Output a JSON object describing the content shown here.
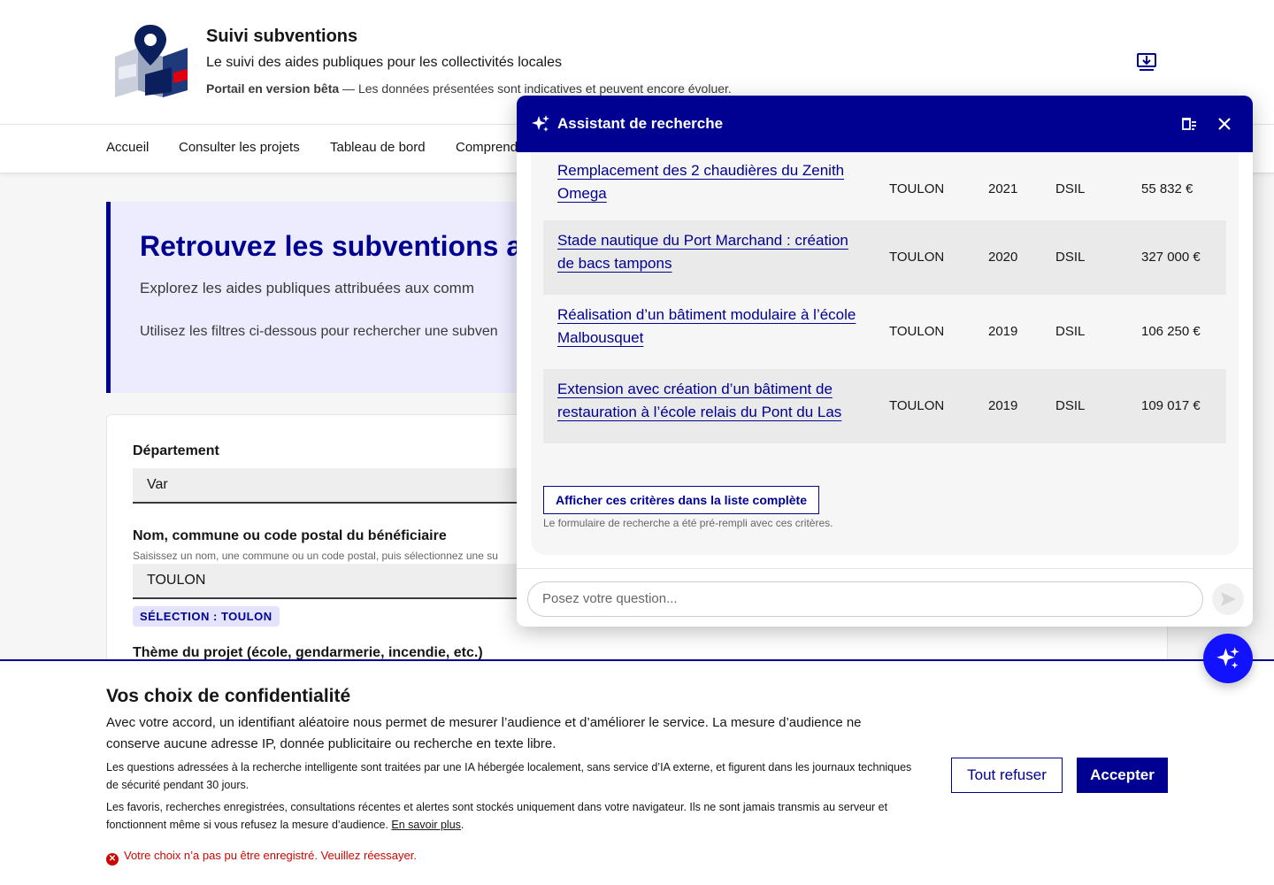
{
  "header": {
    "site_title": "Suivi subventions",
    "tagline": "Le suivi des aides publiques pour les collectivités locales",
    "beta_label": "Portail en version bêta",
    "beta_text": " — Les données présentées sont indicatives et peuvent encore évoluer.",
    "download_icon": "download-icon"
  },
  "nav": {
    "items": [
      "Accueil",
      "Consulter les projets",
      "Tableau de bord",
      "Comprendre"
    ]
  },
  "hero": {
    "title": "Retrouvez les subventions a",
    "subtitle": "Explorez les aides publiques attribuées aux comm",
    "instructions": "Utilisez les filtres ci-dessous pour rechercher une subven"
  },
  "form": {
    "department_label": "Département",
    "department_value": "Var",
    "beneficiary_label": "Nom, commune ou code postal du bénéficiaire",
    "beneficiary_hint": "Saisissez un nom, une commune ou un code postal, puis sélectionnez une su",
    "beneficiary_value": "TOULON",
    "selection_badge": "SÉLECTION : TOULON",
    "theme_label": "Thème du projet (école, gendarmerie, incendie, etc.)"
  },
  "chat": {
    "title": "Assistant de recherche",
    "rows": [
      {
        "title": "Remplacement des 2 chaudières du Zenith Omega",
        "city": "TOULON",
        "year": "2021",
        "program": "DSIL",
        "amount": "55 832 €"
      },
      {
        "title": "Stade nautique du Port Marchand : création de bacs tampons",
        "city": "TOULON",
        "year": "2020",
        "program": "DSIL",
        "amount": "327 000 €"
      },
      {
        "title": "Réalisation d’un bâtiment modulaire à l’école Malbousquet",
        "city": "TOULON",
        "year": "2019",
        "program": "DSIL",
        "amount": "106 250 €"
      },
      {
        "title": "Extension avec création d’un bâtiment de restauration à l’école relais du Pont du Las",
        "city": "TOULON",
        "year": "2019",
        "program": "DSIL",
        "amount": "109 017 €"
      }
    ],
    "criteria_button": "Afficher ces critères dans la liste complète",
    "criteria_note": "Le formulaire de recherche a été pré-rempli avec ces critères.",
    "input_placeholder": "Posez votre question..."
  },
  "consent": {
    "title": "Vos choix de confidentialité",
    "p1": "Avec votre accord, un identifiant aléatoire nous permet de mesurer l’audience et d’améliorer le service. La mesure d’audience ne conserve aucune adresse IP, donnée publicitaire ou recherche en texte libre.",
    "p2": "Les questions adressées à la recherche intelligente sont traitées par une IA hébergée localement, sans service d’IA externe, et figurent dans les journaux techniques de sécurité pendant 30 jours.",
    "p3": "Les favoris, recherches enregistrées, consultations récentes et alertes sont stockés uniquement dans votre navigateur. Ils ne sont jamais transmis au serveur et fonctionnent même si vous refusez la mesure d’audience. ",
    "learn_more": "En savoir plus",
    "p3_end": ".",
    "error": "Votre choix n’a pas pu être enregistré. Veuillez réessayer.",
    "refuse": "Tout refuser",
    "accept": "Accepter"
  },
  "colors": {
    "primary": "#000091",
    "accent": "#1212ff",
    "error": "#ce0500",
    "hero_bg": "#ececfe"
  }
}
